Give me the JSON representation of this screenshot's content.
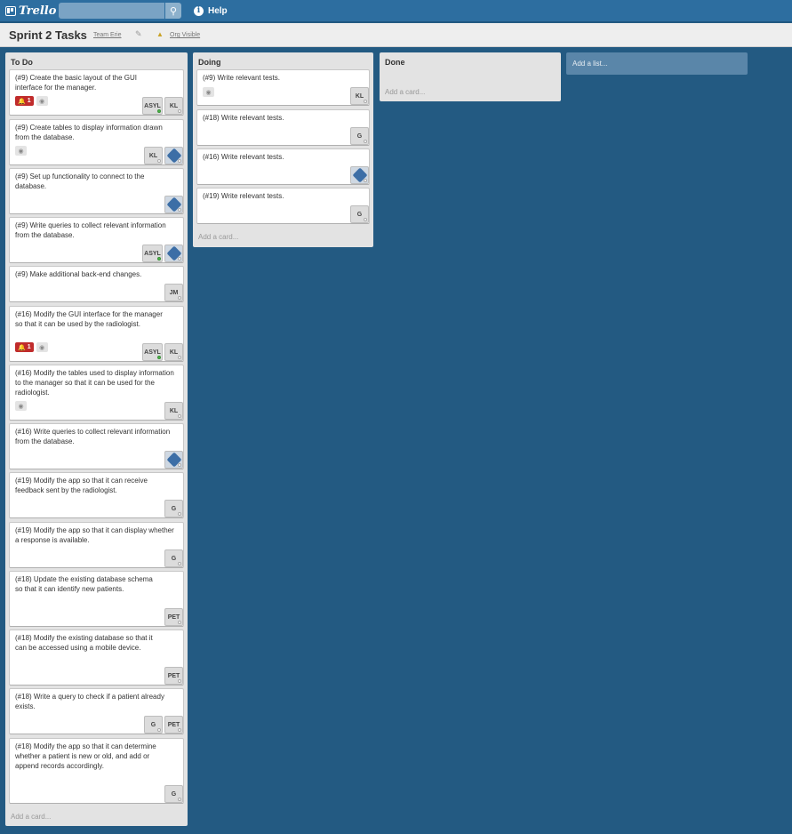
{
  "header": {
    "logo_text": "Trello",
    "search_placeholder": "",
    "help_label": "Help"
  },
  "board": {
    "title": "Sprint 2 Tasks",
    "team_link": "Team Erie",
    "visibility_link": "Org Visible"
  },
  "lists": [
    {
      "title": "To Do",
      "add_card": "Add a card...",
      "cards": [
        {
          "text": "(#9) Create the basic layout of the GUI interface for the manager.",
          "alert": "1",
          "eye": true,
          "members": [
            "ASYL",
            "KL"
          ]
        },
        {
          "text": "(#9) Create tables to display information drawn from the database.",
          "eye": true,
          "members": [
            "KL",
            "avatar"
          ]
        },
        {
          "text": "(#9) Set up functionality to connect to the database.",
          "members": [
            "avatar"
          ]
        },
        {
          "text": "(#9) Write queries to collect relevant information from the database.",
          "members": [
            "ASYL",
            "avatar"
          ]
        },
        {
          "text": "(#9) Make additional back-end changes.",
          "members": [
            "JM"
          ]
        },
        {
          "text": "(#16) Modify the GUI interface for the manager so that it can be used by the radiologist.",
          "alert": "1",
          "eye": true,
          "members": [
            "ASYL",
            "KL"
          ]
        },
        {
          "text": "(#16) Modify the tables used to display information to the manager so that it can be used for the radiologist.",
          "eye": true,
          "members": [
            "KL"
          ]
        },
        {
          "text": "(#16) Write queries to collect relevant information from the database.",
          "members": [
            "avatar"
          ]
        },
        {
          "text": "(#19) Modify the app so that it can receive feedback sent by the radiologist.",
          "members": [
            "G"
          ]
        },
        {
          "text": "(#19) Modify the app so that it can display whether a response is available.",
          "members": [
            "G"
          ]
        },
        {
          "text": "(#18) Update the existing database schema so that it can identify new patients.",
          "members": [
            "PET"
          ]
        },
        {
          "text": "(#18) Modify the existing database so that it can be accessed using a mobile device.",
          "members": [
            "PET"
          ]
        },
        {
          "text": "(#18) Write a query to check if a patient already exists.",
          "members": [
            "G",
            "PET"
          ]
        },
        {
          "text": "(#18) Modify the app so that it can determine whether a patient is new or old, and add or append records accordingly.",
          "members": [
            "G"
          ]
        }
      ]
    },
    {
      "title": "Doing",
      "add_card": "Add a card...",
      "cards": [
        {
          "text": "(#9) Write relevant tests.",
          "eye": true,
          "members": [
            "KL"
          ]
        },
        {
          "text": "(#18) Write relevant tests.",
          "members": [
            "G"
          ]
        },
        {
          "text": "(#16) Write relevant tests.",
          "members": [
            "avatar"
          ]
        },
        {
          "text": "(#19) Write relevant tests.",
          "members": [
            "G"
          ]
        }
      ]
    },
    {
      "title": "Done",
      "add_card": "Add a card...",
      "cards": []
    }
  ],
  "add_list_label": "Add a list...",
  "colors": {
    "background": "#235a82",
    "header": "#2d6ea0",
    "alert": "#c02b2b"
  },
  "icons": {
    "search": "search-icon",
    "help": "info-icon",
    "edit": "pencil-icon",
    "visibility": "org-icon",
    "watch": "eye-icon",
    "alert": "bell-icon"
  }
}
